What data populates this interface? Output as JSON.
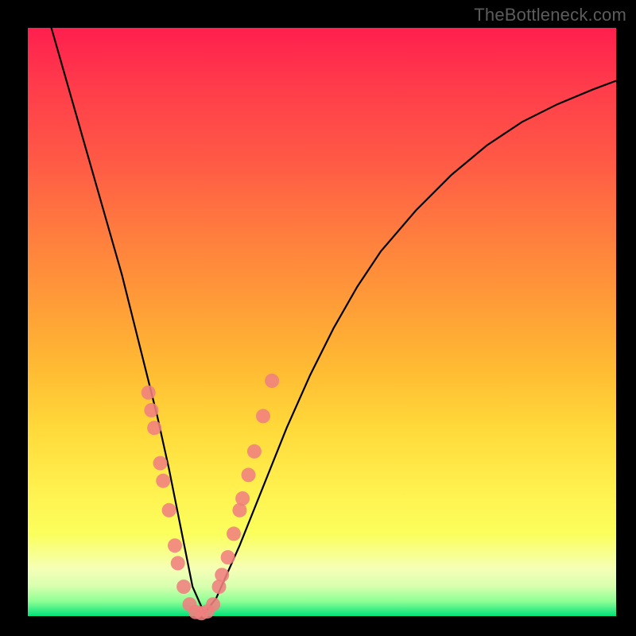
{
  "watermark": "TheBottleneck.com",
  "chart_data": {
    "type": "line",
    "title": "",
    "xlabel": "",
    "ylabel": "",
    "xlim": [
      0,
      100
    ],
    "ylim": [
      0,
      100
    ],
    "grid": false,
    "legend": false,
    "series": [
      {
        "name": "bottleneck-curve",
        "x": [
          4,
          6,
          8,
          10,
          12,
          14,
          16,
          18,
          20,
          22,
          24,
          26,
          28,
          30,
          32,
          36,
          40,
          44,
          48,
          52,
          56,
          60,
          66,
          72,
          78,
          84,
          90,
          96,
          100
        ],
        "y": [
          100,
          93,
          86,
          79,
          72,
          65,
          58,
          50,
          42,
          34,
          25,
          15,
          5,
          0.5,
          3,
          12,
          22,
          32,
          41,
          49,
          56,
          62,
          69,
          75,
          80,
          84,
          87,
          89.5,
          91
        ]
      }
    ],
    "scatter_points": {
      "name": "highlighted-points",
      "color": "#f08080",
      "points": [
        {
          "x": 20.5,
          "y": 38
        },
        {
          "x": 21.0,
          "y": 35
        },
        {
          "x": 21.5,
          "y": 32
        },
        {
          "x": 22.5,
          "y": 26
        },
        {
          "x": 23.0,
          "y": 23
        },
        {
          "x": 24.0,
          "y": 18
        },
        {
          "x": 25.0,
          "y": 12
        },
        {
          "x": 25.5,
          "y": 9
        },
        {
          "x": 26.5,
          "y": 5
        },
        {
          "x": 27.5,
          "y": 2
        },
        {
          "x": 28.5,
          "y": 0.7
        },
        {
          "x": 29.5,
          "y": 0.5
        },
        {
          "x": 30.5,
          "y": 0.8
        },
        {
          "x": 31.5,
          "y": 2
        },
        {
          "x": 32.5,
          "y": 5
        },
        {
          "x": 33.0,
          "y": 7
        },
        {
          "x": 34.0,
          "y": 10
        },
        {
          "x": 35.0,
          "y": 14
        },
        {
          "x": 36.0,
          "y": 18
        },
        {
          "x": 36.5,
          "y": 20
        },
        {
          "x": 37.5,
          "y": 24
        },
        {
          "x": 38.5,
          "y": 28
        },
        {
          "x": 40.0,
          "y": 34
        },
        {
          "x": 41.5,
          "y": 40
        }
      ]
    }
  }
}
